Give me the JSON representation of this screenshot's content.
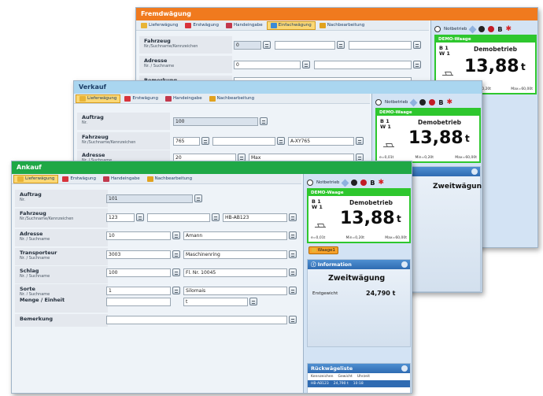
{
  "tabs": {
    "lieferwaegung": "Lieferwägung",
    "erstwaegung": "Erstwägung",
    "handeingabe": "Handeingabe",
    "einfachwaegung": "Einfachwägung",
    "nachbearbeitung": "Nachbearbeitung"
  },
  "toolbar": {
    "notbetrieb": "Notbetrieb",
    "b": "B"
  },
  "scale": {
    "header": "DEMO-Waage",
    "b1": "B 1",
    "w1": "W 1",
    "mode": "Demobetrieb",
    "value": "13,88",
    "unit": "t",
    "e": "e=0,01t",
    "min": "Min=0,20t",
    "max": "Max=60,00t"
  },
  "labels": {
    "fahrzeug": "Fahrzeug",
    "fahrzeug_sub": "Nr./Suchname/Kennzeichen",
    "adresse": "Adresse",
    "adresse_sub": "Nr. / Suchname",
    "bemerkung": "Bemerkung",
    "auftrag": "Auftrag",
    "nr": "Nr.",
    "transporteur": "Transporteur",
    "schlag": "Schlag",
    "sorte": "Sorte",
    "menge": "Menge / Einheit"
  },
  "fremd": {
    "title": "Fremdwägung",
    "fahrzeug_value": "0",
    "adresse_value": "0"
  },
  "verkauf": {
    "title": "Verkauf",
    "auftrag_value": "100",
    "fahrzeug_nr": "765",
    "fahrzeug_kz": "A-XY765",
    "adresse_nr": "20",
    "adresse_name": "Max",
    "info_title": "Zweitwägung"
  },
  "ankauf": {
    "title": "Ankauf",
    "auftrag_value": "101",
    "fahrzeug_nr": "123",
    "fahrzeug_kz": "HB-AB123",
    "adresse_nr": "10",
    "adresse_name": "Amann",
    "transporteur_nr": "3003",
    "transporteur_name": "Maschinenring",
    "schlag_nr": "100",
    "schlag_name": "Fl. Nr. 10045",
    "sorte_nr": "1",
    "sorte_name": "Silomais",
    "menge_unit": "t",
    "waage_btn": "Waage1",
    "information": "Information",
    "info_title": "Zweitwägung",
    "erstgewicht_label": "Erstgewicht",
    "erstgewicht_value": "24,790 t",
    "rueckwaegeliste": "Rückwägeliste",
    "col_kennzeichen": "Kennzeichen",
    "col_gewicht": "Gewicht",
    "col_uhrzeit": "Uhrzeit",
    "row_kennzeichen": "HB-AB123",
    "row_gewicht": "24,790 t",
    "row_uhrzeit": "10:18"
  },
  "colors": {
    "fremd_title": "#f07a1e",
    "verkauf_title": "#aad6f0",
    "ankauf_title": "#1fa846",
    "scale_border": "#2ec72e",
    "section_header": "#2f6bb2"
  }
}
